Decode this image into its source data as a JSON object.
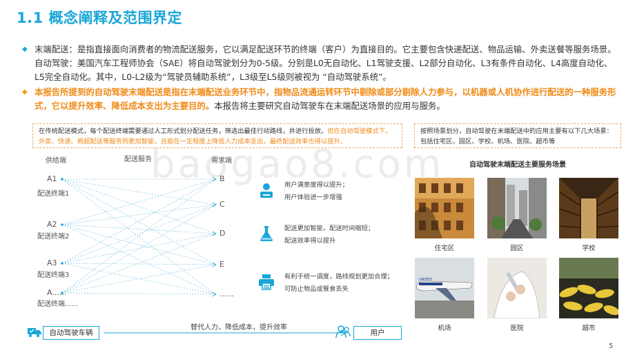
{
  "title": "1.1 概念阐释及范围界定",
  "bullets": [
    {
      "text": "末端配送：是指直接面向消费者的物流配送服务，它以满足配送环节的终端（客户）为直接目的。它主要包含快递配送、物品运输、外卖送餐等服务场景。自动驾驶：美国汽车工程师协会（SAE）将自动驾驶划分为0-5级。分别是L0无自动化、L1驾驶支援、L2部分自动化、L3有条件自动化、L4高度自动化、L5完全自动化。其中，L0-L2级为“驾驶员辅助系统”，L3级至L5级则被视为 “自动驾驶系统”。"
    },
    {
      "highlight": "本报告所提到的自动驾驶末端配送是指在末端配送业务环节中，指物品流通运转环节中剔除或部分剔除人力参与，以机器或人机协作进行配送的一种服务形式，它以提升效率、降低成本支出为主要目的。",
      "rest": "本报告将主要研究自动驾驶车在末端配送场景的应用与服务。"
    }
  ],
  "note_left": {
    "normal": "在传统配送模式，每个配送终端需要通过人工形式划分配送任务，筛选出最佳行动路线，并进行投放。",
    "highlight": "但在自动驾驶模式下，外卖、快递、商超配送等服务则更加智能，且能在一定程度上降低人力成本支出，最终配送效率也得以提升。"
  },
  "note_right": "按照场景划分，自动驾驶在末端配送中的应用主要有以下几大场景：包括住宅区、园区、学校、机场、医院、超市等",
  "diagram": {
    "supply_label": "供给端",
    "service_label": "配送服务",
    "demand_label": "需求端",
    "left_nodes": [
      {
        "name": "A1",
        "sub": "配送终端1"
      },
      {
        "name": "A2",
        "sub": "配送终端2"
      },
      {
        "name": "A3",
        "sub": "配送终端3"
      },
      {
        "name": "A......",
        "sub": "配送终端......"
      }
    ],
    "right_nodes": [
      "B",
      "C",
      "D",
      "E",
      "......"
    ]
  },
  "benefits": [
    {
      "icon": "user-satisfaction-icon",
      "line1": "用户满意度得以提升；",
      "line2": "用户体验进一步增强"
    },
    {
      "icon": "flask-icon",
      "line1": "配送更加智能，配送时间缩短；",
      "line2": "配送效率得以提升"
    },
    {
      "icon": "printer-icon",
      "line1": "有利于统一调度，路线规划更加合理；",
      "line2": "可防止物品或餐食丢失"
    }
  ],
  "scenes_title": "自动驾驶末端配送主要服务场景",
  "scenes": [
    {
      "caption": "住宅区"
    },
    {
      "caption": "园区"
    },
    {
      "caption": "学校"
    },
    {
      "caption": "机场"
    },
    {
      "caption": "医院"
    },
    {
      "caption": "超市"
    }
  ],
  "bottom": {
    "vehicle": "自动驾驶车辆",
    "arrow_label": "替代人力，降低成本，提升效率",
    "user": "用户"
  },
  "page_number": "5",
  "watermark": "baogao8.com",
  "colors": {
    "accent": "#19a6d8",
    "highlight": "#f08a16"
  }
}
